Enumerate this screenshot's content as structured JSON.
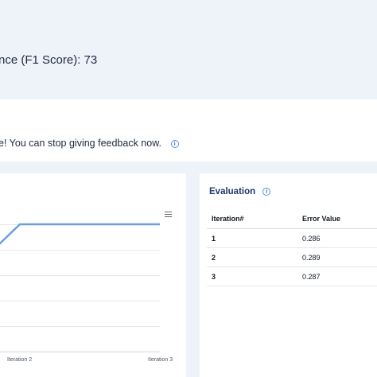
{
  "performance": {
    "text": "nce (F1 Score): 73"
  },
  "feedback": {
    "text": "e! You can stop giving feedback now.",
    "info_icon": "info-circle-icon"
  },
  "chart": {
    "menu_icon": "hamburger-menu-icon",
    "line_color": "#6a9fdc",
    "chart_data": {
      "type": "line",
      "categories": [
        "Iteration 2",
        "Iteration 3"
      ],
      "series": [
        {
          "values": [
            0.289,
            0.289
          ]
        }
      ]
    },
    "x_tick_labels": [
      "Iteration 2",
      "Iteration 3"
    ]
  },
  "evaluation": {
    "title": "Evaluation",
    "info_icon": "info-circle-icon",
    "columns": [
      "Iteration#",
      "Error Value"
    ],
    "rows": [
      {
        "iteration": "1",
        "error": "0.286"
      },
      {
        "iteration": "2",
        "error": "0.289"
      },
      {
        "iteration": "3",
        "error": "0.287"
      }
    ]
  },
  "colors": {
    "background": "#eef3fa",
    "card": "#ffffff",
    "accent": "#5b8fd6",
    "title": "#1e3a6e"
  }
}
